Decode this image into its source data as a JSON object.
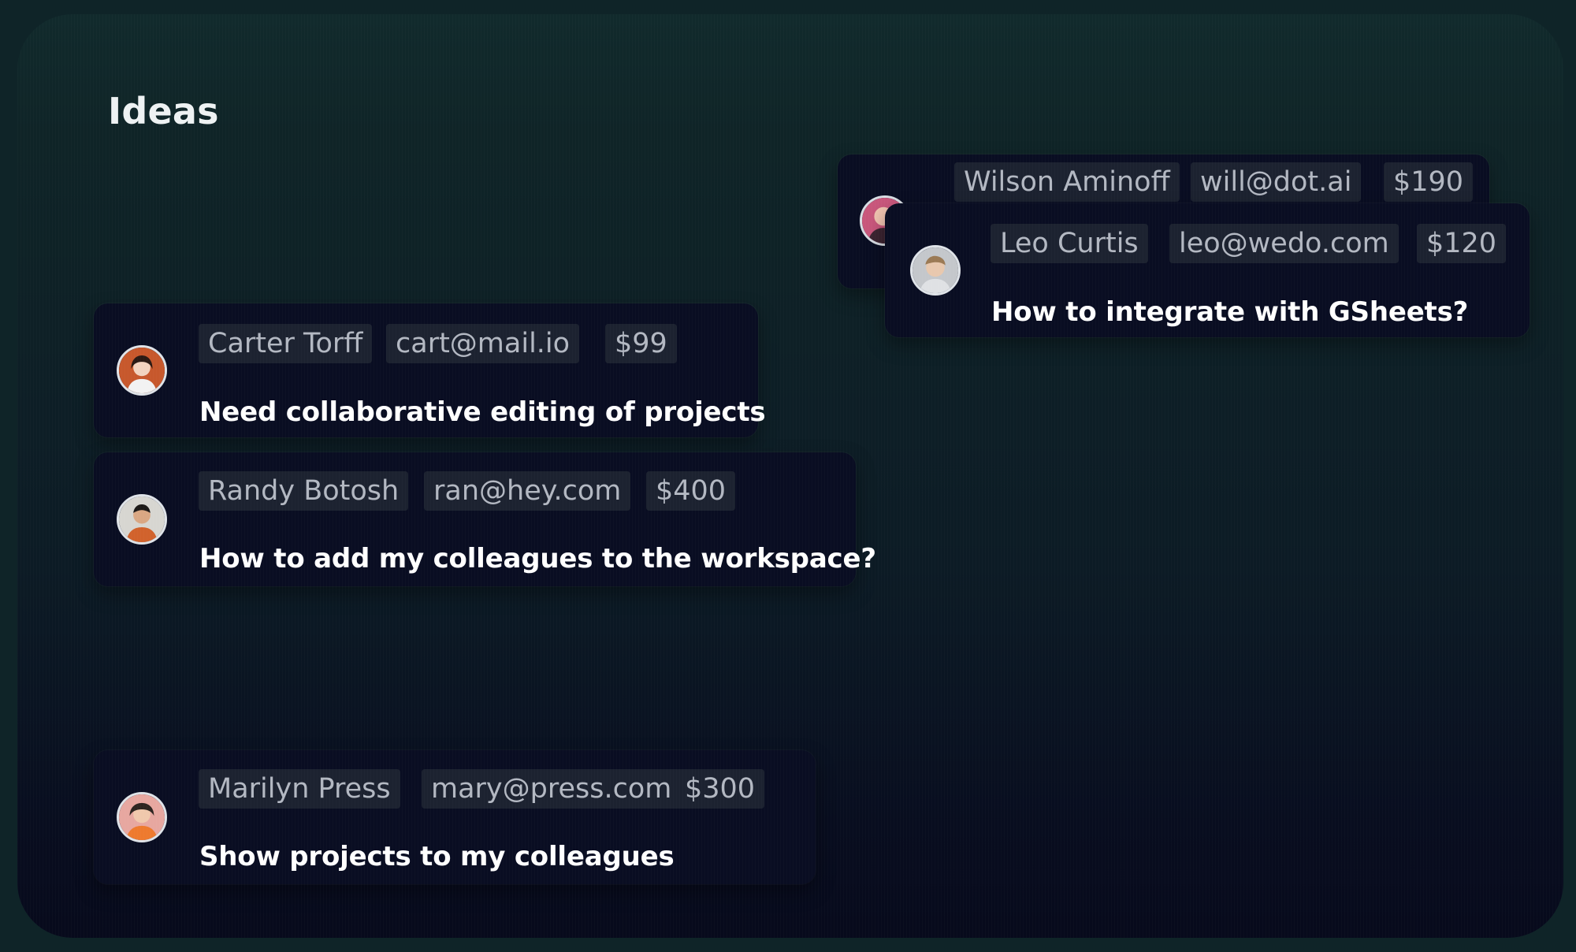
{
  "page": {
    "title": "Ideas"
  },
  "cards": [
    {
      "name": "Wilson Aminoff",
      "email": "will@dot.ai",
      "amount": "$190",
      "message": "",
      "avatar": "person-avatar"
    },
    {
      "name": "Leo Curtis",
      "email": "leo@wedo.com",
      "amount": "$120",
      "message": "How to integrate with GSheets?",
      "avatar": "person-avatar"
    },
    {
      "name": "Carter Torff",
      "email": "cart@mail.io",
      "amount": "$99",
      "message": "Need collaborative editing of projects",
      "avatar": "person-avatar"
    },
    {
      "name": "Randy Botosh",
      "email": "ran@hey.com",
      "amount": "$400",
      "message": "How to add my colleagues to the workspace?",
      "avatar": "person-avatar"
    },
    {
      "name": "Marilyn Press",
      "email": "mary@press.com",
      "amount": "$300",
      "message": "Show projects to my colleagues",
      "avatar": "person-avatar"
    }
  ]
}
